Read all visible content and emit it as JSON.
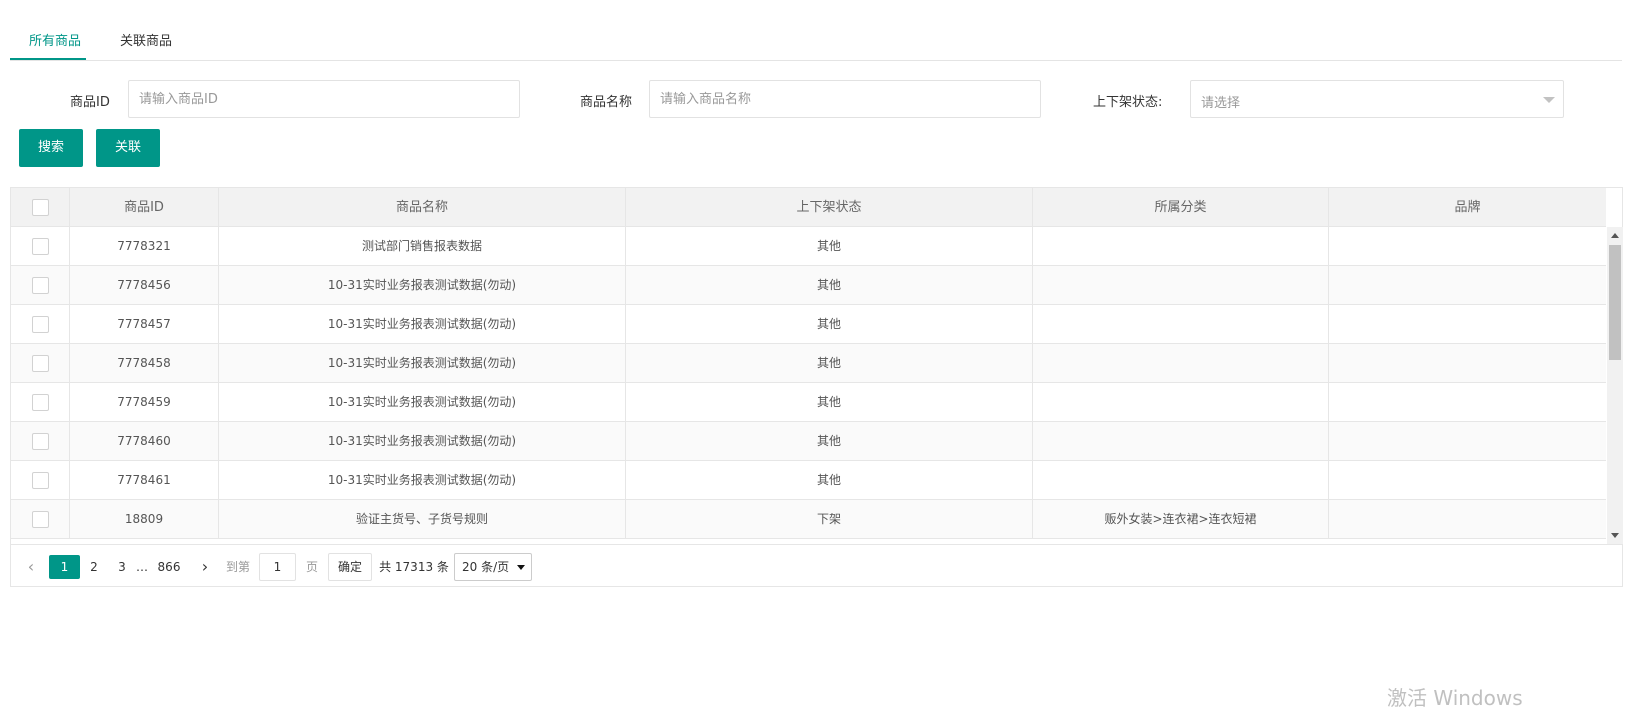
{
  "tabs": [
    {
      "label": "所有商品",
      "active": true
    },
    {
      "label": "关联商品",
      "active": false
    }
  ],
  "form": {
    "id_label": "商品ID",
    "id_placeholder": "请输入商品ID",
    "name_label": "商品名称",
    "name_placeholder": "请输入商品名称",
    "status_label": "上下架状态:",
    "status_placeholder": "请选择"
  },
  "buttons": {
    "search": "搜索",
    "link": "关联"
  },
  "table": {
    "headers": [
      "商品ID",
      "商品名称",
      "上下架状态",
      "所属分类",
      "品牌"
    ],
    "rows": [
      {
        "id": "7778321",
        "name": "测试部门销售报表数据",
        "status": "其他",
        "category": "",
        "brand": ""
      },
      {
        "id": "7778456",
        "name": "10-31实时业务报表测试数据(勿动)",
        "status": "其他",
        "category": "",
        "brand": ""
      },
      {
        "id": "7778457",
        "name": "10-31实时业务报表测试数据(勿动)",
        "status": "其他",
        "category": "",
        "brand": ""
      },
      {
        "id": "7778458",
        "name": "10-31实时业务报表测试数据(勿动)",
        "status": "其他",
        "category": "",
        "brand": ""
      },
      {
        "id": "7778459",
        "name": "10-31实时业务报表测试数据(勿动)",
        "status": "其他",
        "category": "",
        "brand": ""
      },
      {
        "id": "7778460",
        "name": "10-31实时业务报表测试数据(勿动)",
        "status": "其他",
        "category": "",
        "brand": ""
      },
      {
        "id": "7778461",
        "name": "10-31实时业务报表测试数据(勿动)",
        "status": "其他",
        "category": "",
        "brand": ""
      },
      {
        "id": "18809",
        "name": "验证主货号、子货号规则",
        "status": "下架",
        "category": "贩外女装>连衣裙>连衣短裙",
        "brand": ""
      }
    ]
  },
  "pagination": {
    "pages": [
      "1",
      "2",
      "3"
    ],
    "ellipsis": "…",
    "last_page": "866",
    "current": "1",
    "goto_label": "到第",
    "goto_value": "1",
    "page_suffix": "页",
    "confirm": "确定",
    "total": "共 17313 条",
    "page_size": "20 条/页"
  },
  "watermark": "激活 Windows",
  "colors": {
    "accent": "#009688",
    "header_bg": "#f2f2f2",
    "border": "#e6e6e6"
  }
}
